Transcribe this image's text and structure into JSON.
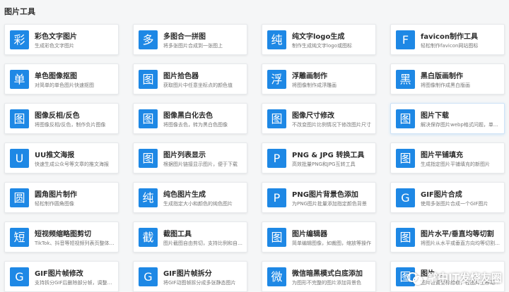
{
  "section": {
    "title": "图片工具"
  },
  "tools": [
    {
      "icon": "彩",
      "name": "彩色文字图片",
      "desc": "生成彩色文字图片"
    },
    {
      "icon": "多",
      "name": "多图合一拼图",
      "desc": "将多张图片合成到一张图上"
    },
    {
      "icon": "纯",
      "name": "纯文字logo生成",
      "desc": "制作生成纯文字logo或图标"
    },
    {
      "icon": "F",
      "name": "favicon制作工具",
      "desc": "轻松制作favicon网站图标"
    },
    {
      "icon": "单",
      "name": "单色图像抠图",
      "desc": "对简单的单色图片快速抠图"
    },
    {
      "icon": "图",
      "name": "图片拾色器",
      "desc": "获取图片中任意坐标点的颜色值"
    },
    {
      "icon": "浮",
      "name": "浮雕画制作",
      "desc": "将图像制作成浮雕画"
    },
    {
      "icon": "黑",
      "name": "黑白版画制作",
      "desc": "将图像制作成黑白版画"
    },
    {
      "icon": "图",
      "name": "图像反相/反色",
      "desc": "将图像反相/反色，制作负片图像"
    },
    {
      "icon": "图",
      "name": "图像黑白化去色",
      "desc": "将图像去色，转为黑白色图像"
    },
    {
      "icon": "图",
      "name": "图像尺寸修改",
      "desc": "不改变图片比例情况下修改图片尺寸"
    },
    {
      "icon": "图",
      "name": "图片下载",
      "desc": "解决保存图片webp格式问题，单…",
      "highlight": true
    },
    {
      "icon": "U",
      "name": "UU推文海报",
      "desc": "快速生成公众号等文章的推文海报"
    },
    {
      "icon": "图",
      "name": "图片列表显示",
      "desc": "根据图片链接显示图片，便于下载"
    },
    {
      "icon": "P",
      "name": "PNG & JPG 转换工具",
      "desc": "高效批量PNG和JPG互转工具"
    },
    {
      "icon": "图",
      "name": "图片平铺填充",
      "desc": "生成指定图片平铺填充的新图片"
    },
    {
      "icon": "圆",
      "name": "圆角图片制作",
      "desc": "轻松制作圆角图像"
    },
    {
      "icon": "纯",
      "name": "纯色图片生成",
      "desc": "生成指定大小和颜色的纯色图片"
    },
    {
      "icon": "P",
      "name": "PNG图片背景色添加",
      "desc": "为PNG图片批量添加指定颜色背景"
    },
    {
      "icon": "G",
      "name": "GIF图片合成",
      "desc": "使用多张图片合成一个GIF图片"
    },
    {
      "icon": "短",
      "name": "短视频缩略图剪切",
      "desc": "TikTok、抖音等短视频列表页整体…"
    },
    {
      "icon": "截",
      "name": "截图工具",
      "desc": "图片截图自由剪切，支持比例和自…"
    },
    {
      "icon": "图",
      "name": "图片编辑器",
      "desc": "简单编辑图像，如裁图，缩放等操作"
    },
    {
      "icon": "图",
      "name": "图片水平/垂直均等切割",
      "desc": "将图片从水平或垂直方向均等切割…"
    },
    {
      "icon": "G",
      "name": "GIF图片帧修改",
      "desc": "支持拆分GIF后删除部分帧，调整…"
    },
    {
      "icon": "G",
      "name": "GIF图片帧拆分",
      "desc": "将GIF动图帧拆分成多张静态图片"
    },
    {
      "icon": "微",
      "name": "微信暗黑模式白底添加",
      "desc": "为图形不完整的图片添加背景色"
    },
    {
      "icon": "图",
      "name": "图片...",
      "desc": "图片位置坐标拾取，在图片上移动…"
    }
  ],
  "watermark": {
    "text": "掌中IT发烧友圈",
    "icon": "wechat-logo-icon"
  },
  "colors": {
    "accent": "#1e88e5",
    "page_bg": "#f5f6f7"
  }
}
